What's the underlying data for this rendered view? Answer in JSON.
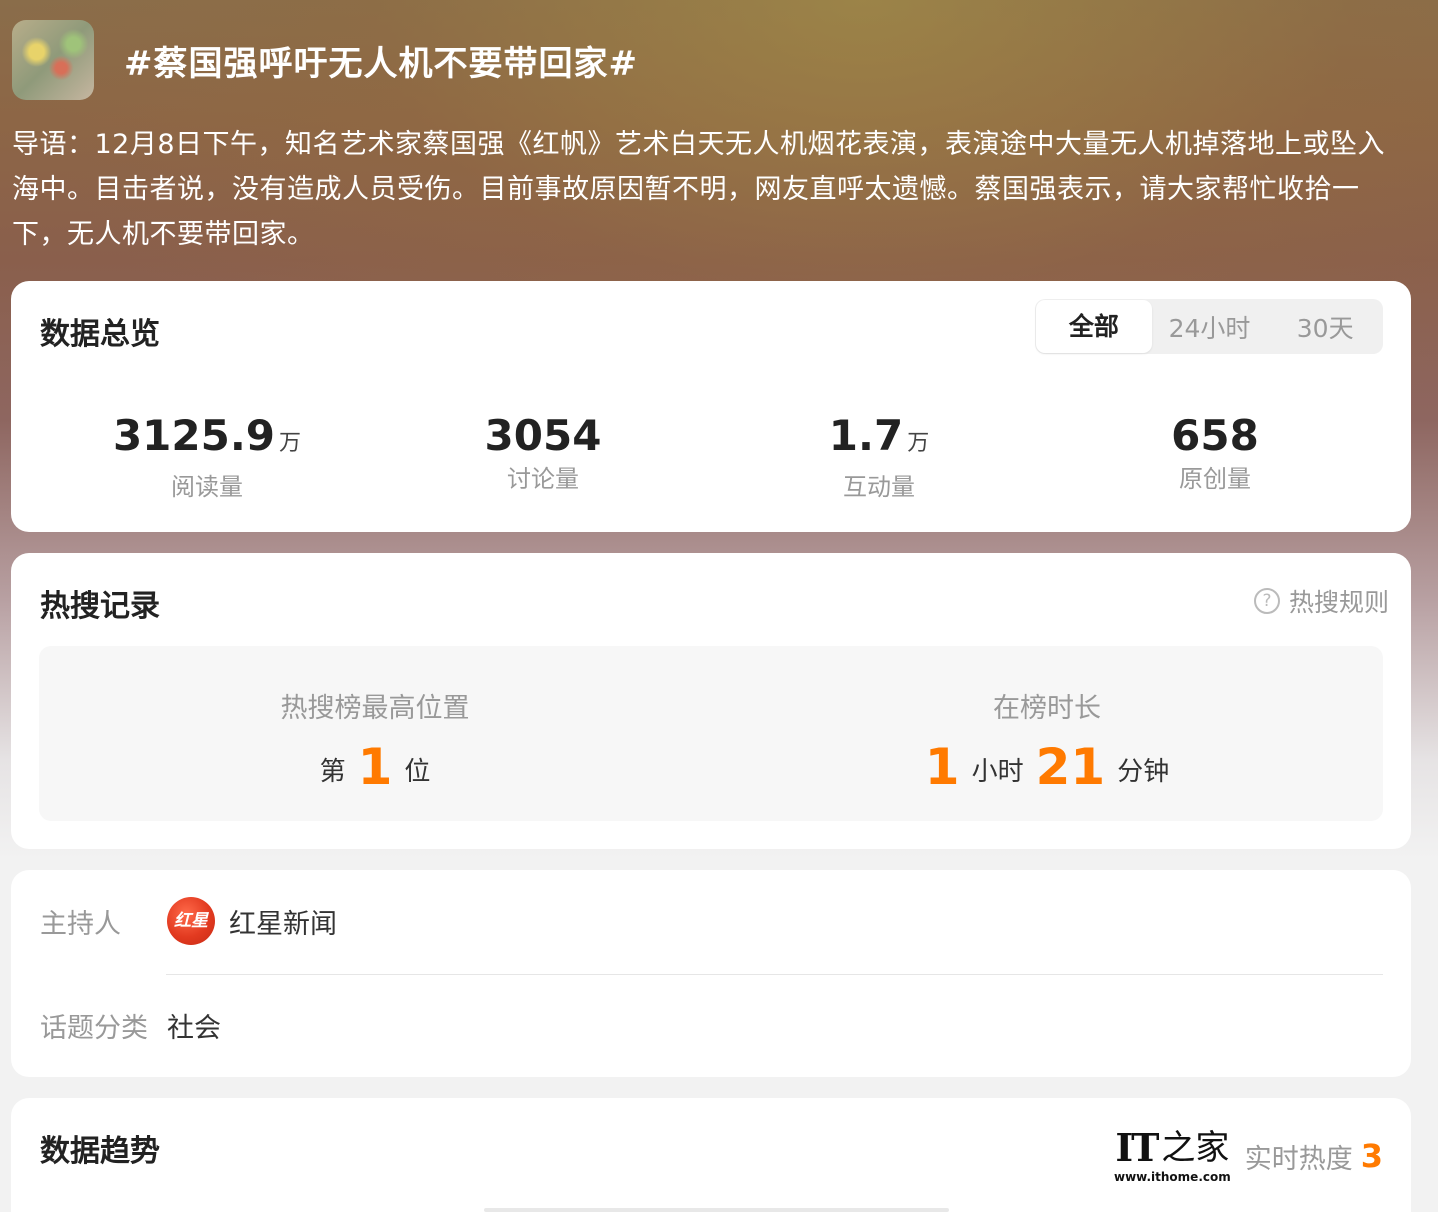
{
  "topic": {
    "title": "#蔡国强呼吁无人机不要带回家#",
    "intro": "导语：12月8日下午，知名艺术家蔡国强《红帆》艺术白天无人机烟花表演，表演途中大量无人机掉落地上或坠入海中。目击者说，没有造成人员受伤。目前事故原因暂不明，网友直呼太遗憾。蔡国强表示，请大家帮忙收拾一下，无人机不要带回家。"
  },
  "overview": {
    "title": "数据总览",
    "tabs": [
      "全部",
      "24小时",
      "30天"
    ],
    "active_tab": "全部",
    "stats": [
      {
        "value": "3125.9",
        "unit": "万",
        "label": "阅读量"
      },
      {
        "value": "3054",
        "unit": "",
        "label": "讨论量"
      },
      {
        "value": "1.7",
        "unit": "万",
        "label": "互动量"
      },
      {
        "value": "658",
        "unit": "",
        "label": "原创量"
      }
    ]
  },
  "hot_search": {
    "title": "热搜记录",
    "rules_label": "热搜规则",
    "rules_icon": "question-circle-icon",
    "peak_label": "热搜榜最高位置",
    "peak_prefix": "第",
    "peak_value": "1",
    "peak_suffix": "位",
    "duration_label": "在榜时长",
    "duration_hours": "1",
    "duration_hours_unit": "小时",
    "duration_minutes": "21",
    "duration_minutes_unit": "分钟"
  },
  "info": {
    "host_label": "主持人",
    "host_name": "红星新闻",
    "host_logo_text": "红星",
    "category_label": "话题分类",
    "category_value": "社会"
  },
  "trend": {
    "title": "数据趋势",
    "heat_label": "实时热度",
    "heat_value": "3"
  },
  "watermark": {
    "logo": "IT",
    "logo_zh": "之家",
    "url": "www.ithome.com"
  },
  "colors": {
    "accent": "#ff7a00",
    "card_bg": "#ffffff",
    "muted_text": "#999999"
  }
}
